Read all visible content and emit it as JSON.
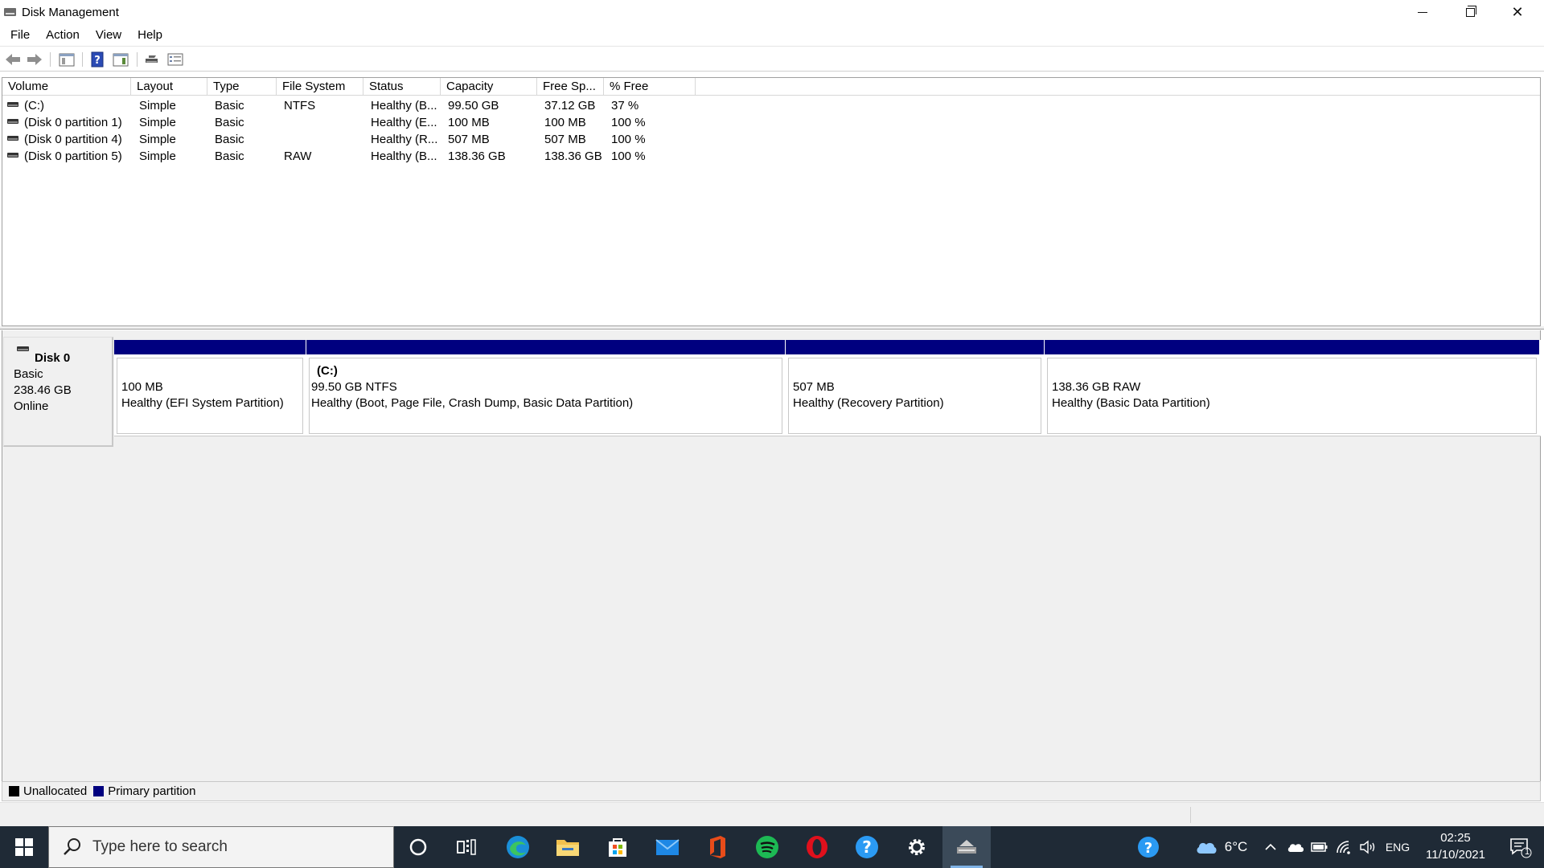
{
  "window": {
    "title": "Disk Management"
  },
  "menu": [
    "File",
    "Action",
    "View",
    "Help"
  ],
  "volume_list": {
    "columns": [
      "Volume",
      "Layout",
      "Type",
      "File System",
      "Status",
      "Capacity",
      "Free Sp...",
      "% Free"
    ],
    "rows": [
      {
        "volume": "(C:)",
        "layout": "Simple",
        "type": "Basic",
        "fs": "NTFS",
        "status": "Healthy (B...",
        "capacity": "99.50 GB",
        "free": "37.12 GB",
        "pct": "37 %"
      },
      {
        "volume": "(Disk 0 partition 1)",
        "layout": "Simple",
        "type": "Basic",
        "fs": "",
        "status": "Healthy (E...",
        "capacity": "100 MB",
        "free": "100 MB",
        "pct": "100 %"
      },
      {
        "volume": "(Disk 0 partition 4)",
        "layout": "Simple",
        "type": "Basic",
        "fs": "",
        "status": "Healthy (R...",
        "capacity": "507 MB",
        "free": "507 MB",
        "pct": "100 %"
      },
      {
        "volume": "(Disk 0 partition 5)",
        "layout": "Simple",
        "type": "Basic",
        "fs": "RAW",
        "status": "Healthy (B...",
        "capacity": "138.36 GB",
        "free": "138.36 GB",
        "pct": "100 %"
      }
    ]
  },
  "disk": {
    "name": "Disk 0",
    "type": "Basic",
    "size": "238.46 GB",
    "state": "Online",
    "partitions": [
      {
        "title": "",
        "size": "100 MB",
        "status": "Healthy (EFI System Partition)"
      },
      {
        "title": "(C:)",
        "size": "99.50 GB NTFS",
        "status": "Healthy (Boot, Page File, Crash Dump, Basic Data Partition)"
      },
      {
        "title": "",
        "size": "507 MB",
        "status": "Healthy (Recovery Partition)"
      },
      {
        "title": "",
        "size": "138.36 GB RAW",
        "status": "Healthy (Basic Data Partition)"
      }
    ]
  },
  "legend": [
    {
      "label": "Unallocated",
      "color": "#000000"
    },
    {
      "label": "Primary partition",
      "color": "#00007f"
    }
  ],
  "taskbar": {
    "search_placeholder": "Type here to search",
    "weather": "6°C",
    "language": "ENG",
    "time": "02:25",
    "date": "11/10/2021",
    "notifications": "1"
  },
  "colors": {
    "partition_bar": "#00007f",
    "taskbar_bg": "#1f2a36"
  }
}
